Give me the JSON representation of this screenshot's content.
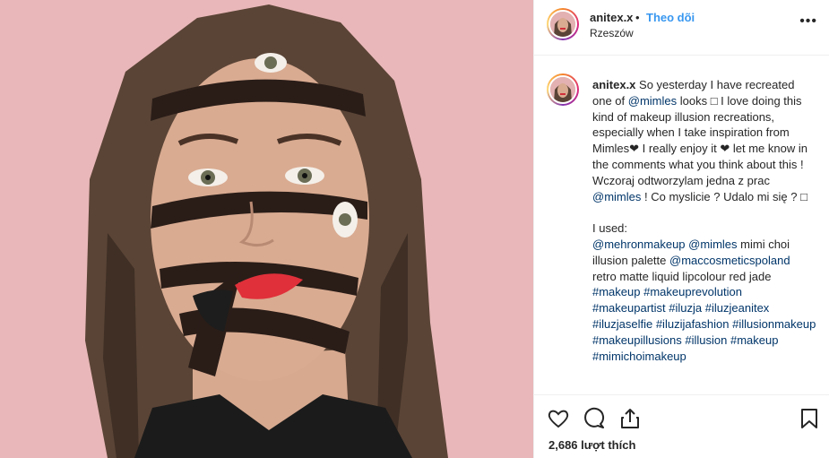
{
  "post": {
    "username": "anitex.x",
    "follow_label": "Theo dõi",
    "separator": "•",
    "location": "Rzeszów",
    "more_label": "•••"
  },
  "caption": {
    "username": "anitex.x",
    "segments": [
      {
        "text": " So yesterday I have recreated one of ",
        "link": false
      },
      {
        "text": "@mimles",
        "link": true
      },
      {
        "text": " looks □ I love doing this kind of makeup illusion recreations, especially when I take inspiration from Mimles❤ I really enjoy it ❤ let me know in the comments what you think about this ! Wczoraj odtworzylam jedna z prac ",
        "link": false
      },
      {
        "text": "@mimles",
        "link": true
      },
      {
        "text": " ! Co myslicie ? Udalo mi się ? □\n\nI used:\n",
        "link": false
      },
      {
        "text": "@mehronmakeup",
        "link": true
      },
      {
        "text": " ",
        "link": false
      },
      {
        "text": "@mimles",
        "link": true
      },
      {
        "text": " mimi choi illusion palette ",
        "link": false
      },
      {
        "text": "@maccosmeticspoland",
        "link": true
      },
      {
        "text": " retro matte liquid lipcolour red jade ",
        "link": false
      },
      {
        "text": "#makeup",
        "link": true
      },
      {
        "text": " ",
        "link": false
      },
      {
        "text": "#makeuprevolution",
        "link": true
      },
      {
        "text": " ",
        "link": false
      },
      {
        "text": "#makeupartist",
        "link": true
      },
      {
        "text": " ",
        "link": false
      },
      {
        "text": "#iluzja",
        "link": true
      },
      {
        "text": " ",
        "link": false
      },
      {
        "text": "#iluzjeanitex",
        "link": true
      },
      {
        "text": " ",
        "link": false
      },
      {
        "text": "#iluzjaselfie",
        "link": true
      },
      {
        "text": " ",
        "link": false
      },
      {
        "text": "#iluzijafashion",
        "link": true
      },
      {
        "text": " ",
        "link": false
      },
      {
        "text": "#illusionmakeup",
        "link": true
      },
      {
        "text": " ",
        "link": false
      },
      {
        "text": "#makeupillusions",
        "link": true
      },
      {
        "text": " ",
        "link": false
      },
      {
        "text": "#illusion",
        "link": true
      },
      {
        "text": " ",
        "link": false
      },
      {
        "text": "#makeup",
        "link": true
      },
      {
        "text": " ",
        "link": false
      },
      {
        "text": "#mimichoimakeup",
        "link": true
      }
    ]
  },
  "actions": {
    "like_icon": "heart-icon",
    "comment_icon": "comment-icon",
    "share_icon": "share-icon",
    "save_icon": "bookmark-icon",
    "likes_text": "2,686 lượt thích"
  },
  "colors": {
    "link": "#003569",
    "follow": "#3897f0",
    "background": "#e9b7b9"
  }
}
